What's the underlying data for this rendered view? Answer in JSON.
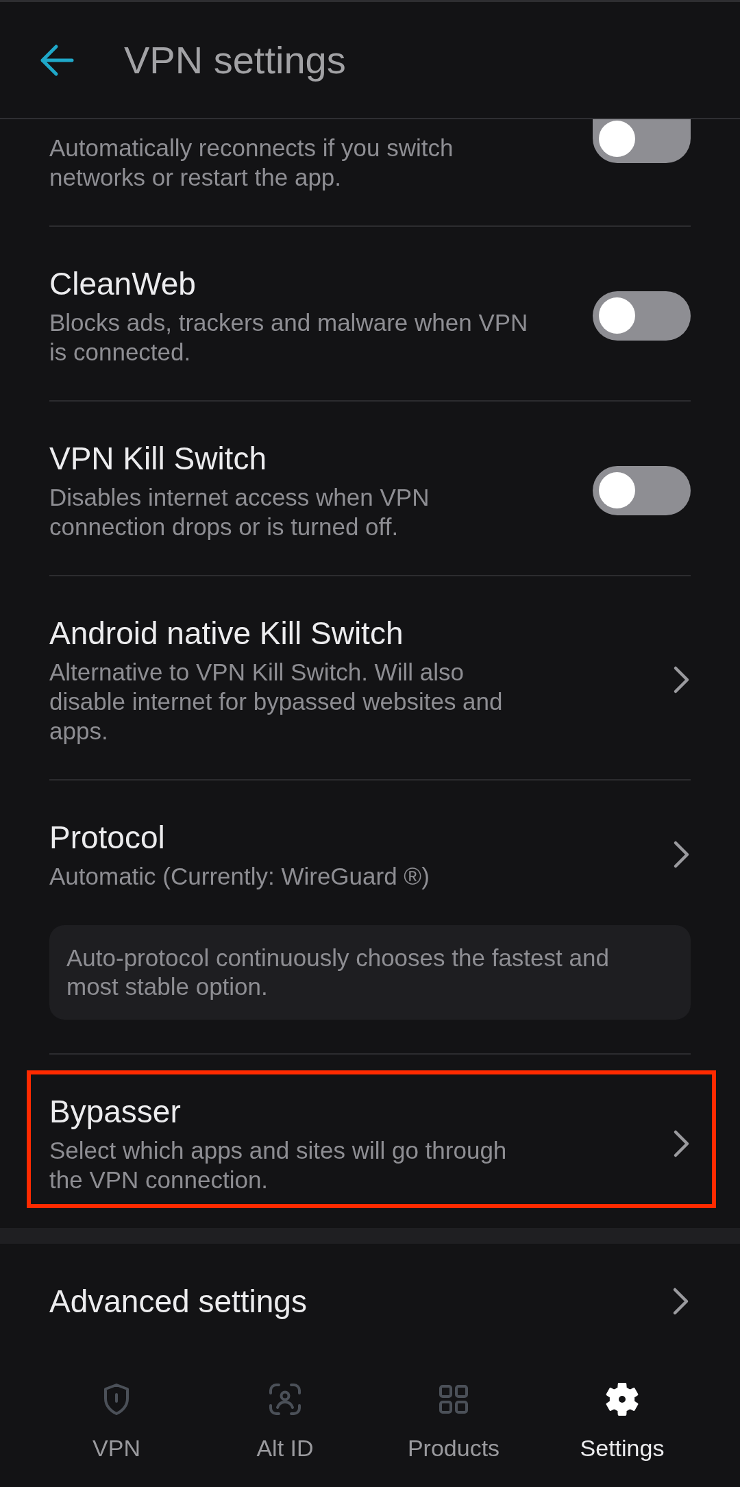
{
  "header": {
    "title": "VPN settings"
  },
  "settings": [
    {
      "kind": "toggle",
      "description": "Automatically reconnects if you switch networks or restart the app.",
      "on": false,
      "highlighted": false
    },
    {
      "kind": "toggle",
      "title": "CleanWeb",
      "description": "Blocks ads, trackers and malware when VPN is connected.",
      "on": false,
      "highlighted": false
    },
    {
      "kind": "toggle",
      "title": "VPN Kill Switch",
      "description": "Disables internet access when VPN connection drops or is turned off.",
      "on": false,
      "highlighted": false
    },
    {
      "kind": "link",
      "title": "Android native Kill Switch",
      "description": "Alternative to VPN Kill Switch. Will also disable internet for bypassed websites and apps.",
      "highlighted": false
    },
    {
      "kind": "link",
      "title": "Protocol",
      "description": "Automatic (Currently: WireGuard ®)",
      "note": "Auto-protocol continuously chooses the fastest and most stable option.",
      "highlighted": false
    },
    {
      "kind": "link",
      "title": "Bypasser",
      "description": "Select which apps and sites will go through the VPN connection.",
      "highlighted": true
    }
  ],
  "advanced": {
    "title": "Advanced settings"
  },
  "nav": [
    {
      "label": "VPN",
      "selected": false
    },
    {
      "label": "Alt ID",
      "selected": false
    },
    {
      "label": "Products",
      "selected": false
    },
    {
      "label": "Settings",
      "selected": true
    }
  ]
}
